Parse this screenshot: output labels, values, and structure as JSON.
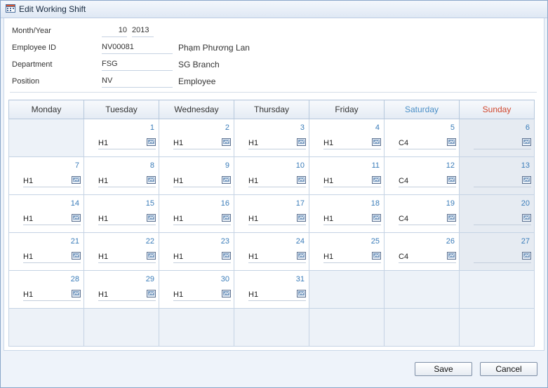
{
  "window": {
    "title": "Edit Working Shift",
    "icon": "calendar-icon"
  },
  "form": {
    "month_label": "Month/Year",
    "month_value": "10",
    "year_value": "2013",
    "employee_id_label": "Employee ID",
    "employee_id_value": "NV00081",
    "employee_name": "Phạm Phương Lan",
    "department_label": "Department",
    "department_value": "FSG",
    "department_name": "SG Branch",
    "position_label": "Position",
    "position_value": "NV",
    "position_name": "Employee"
  },
  "calendar": {
    "weekday_color_saturday": "#4a8fc7",
    "weekday_color_sunday": "#d1462c",
    "days": [
      "Monday",
      "Tuesday",
      "Wednesday",
      "Thursday",
      "Friday",
      "Saturday",
      "Sunday"
    ],
    "weeks": [
      [
        null,
        {
          "day": "1",
          "shift": "H1"
        },
        {
          "day": "2",
          "shift": "H1"
        },
        {
          "day": "3",
          "shift": "H1"
        },
        {
          "day": "4",
          "shift": "H1"
        },
        {
          "day": "5",
          "shift": "C4"
        },
        {
          "day": "6",
          "shift": ""
        }
      ],
      [
        {
          "day": "7",
          "shift": "H1"
        },
        {
          "day": "8",
          "shift": "H1"
        },
        {
          "day": "9",
          "shift": "H1"
        },
        {
          "day": "10",
          "shift": "H1"
        },
        {
          "day": "11",
          "shift": "H1"
        },
        {
          "day": "12",
          "shift": "C4"
        },
        {
          "day": "13",
          "shift": ""
        }
      ],
      [
        {
          "day": "14",
          "shift": "H1"
        },
        {
          "day": "15",
          "shift": "H1"
        },
        {
          "day": "16",
          "shift": "H1"
        },
        {
          "day": "17",
          "shift": "H1"
        },
        {
          "day": "18",
          "shift": "H1"
        },
        {
          "day": "19",
          "shift": "C4"
        },
        {
          "day": "20",
          "shift": ""
        }
      ],
      [
        {
          "day": "21",
          "shift": "H1"
        },
        {
          "day": "22",
          "shift": "H1"
        },
        {
          "day": "23",
          "shift": "H1"
        },
        {
          "day": "24",
          "shift": "H1"
        },
        {
          "day": "25",
          "shift": "H1"
        },
        {
          "day": "26",
          "shift": "C4"
        },
        {
          "day": "27",
          "shift": ""
        }
      ],
      [
        {
          "day": "28",
          "shift": "H1"
        },
        {
          "day": "29",
          "shift": "H1"
        },
        {
          "day": "30",
          "shift": "H1"
        },
        {
          "day": "31",
          "shift": "H1"
        },
        null,
        null,
        null
      ],
      [
        null,
        null,
        null,
        null,
        null,
        null,
        null
      ]
    ]
  },
  "buttons": {
    "save": "Save",
    "cancel": "Cancel"
  }
}
